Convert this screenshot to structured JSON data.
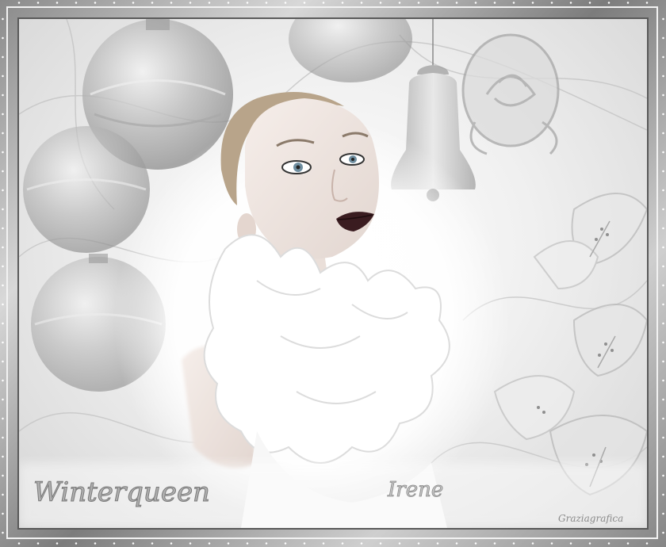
{
  "title_script": "Winterqueen",
  "name_script": "Irene",
  "credit": "Graziagrafica",
  "palette": {
    "frame_dark": "#5a5a5a",
    "frame_light": "#d8d8d8",
    "background": "#f0f0f0",
    "ornament": "#9a9a9a",
    "lips": "#3a1c20"
  },
  "icons": [
    "christmas-ornament-icon",
    "bell-icon",
    "rose-icon",
    "lily-icon"
  ]
}
